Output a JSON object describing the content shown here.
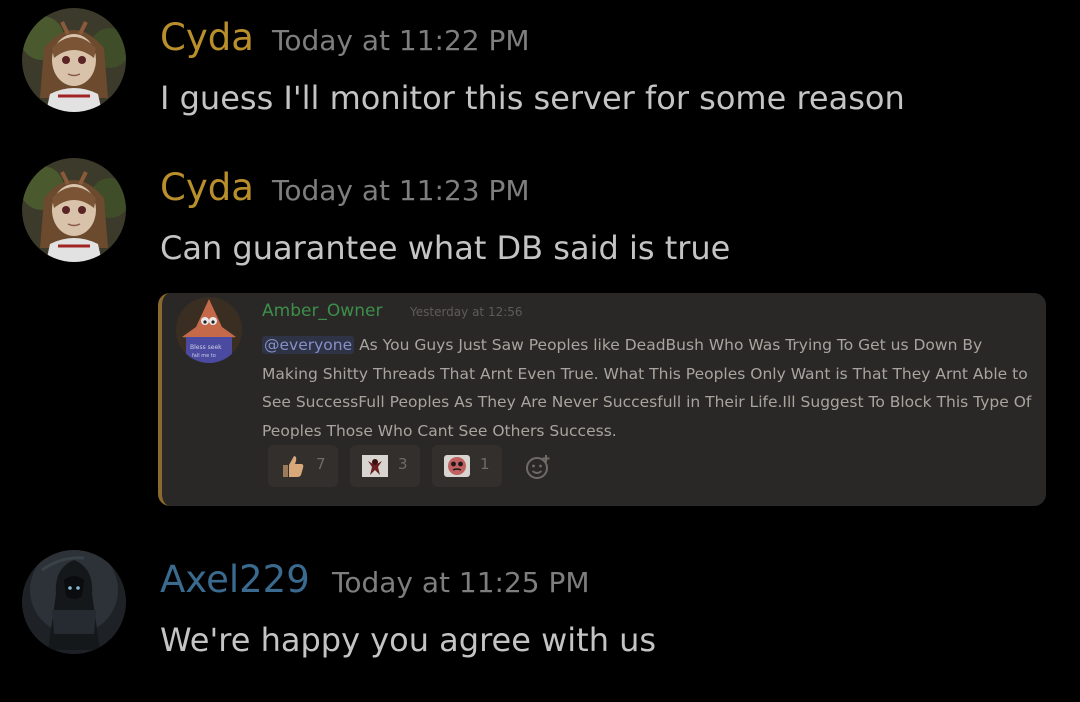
{
  "messages": [
    {
      "username": "Cyda",
      "username_color": "#b98f2c",
      "timestamp": "Today at 11:22 PM",
      "content": "I guess I'll monitor this server for some reason",
      "avatar_icon": "anime-girl-avatar"
    },
    {
      "username": "Cyda",
      "username_color": "#b98f2c",
      "timestamp": "Today at 11:23 PM",
      "content": "Can  guarantee what DB said is true",
      "avatar_icon": "anime-girl-avatar"
    },
    {
      "username": "Axel229",
      "username_color": "#3a6a8e",
      "timestamp": "Today at 11:25 PM",
      "content": "We're happy you agree with us",
      "avatar_icon": "hooded-warrior-avatar"
    }
  ],
  "embed": {
    "username": "Amber_Owner",
    "timestamp": "Yesterday at 12:56",
    "mention": "@everyone",
    "text": " As You Guys Just Saw Peoples like DeadBush Who Was Trying To Get us Down By Making Shitty Threads That Arnt Even True. What This Peoples Only Want is That They Arnt Able to See SuccessFull Peoples As They Are Never Succesfull in Their Life.Ill Suggest To Block This Type Of Peoples Those Who Cant See Others Success.",
    "avatar_icon": "patrick-star-avatar",
    "reactions": [
      {
        "icon": "thumbs-up-icon",
        "count": "7"
      },
      {
        "icon": "custom-emoji-figure-icon",
        "count": "3"
      },
      {
        "icon": "custom-emoji-face-icon",
        "count": "1"
      }
    ],
    "add_reaction_icon": "add-reaction-icon"
  }
}
